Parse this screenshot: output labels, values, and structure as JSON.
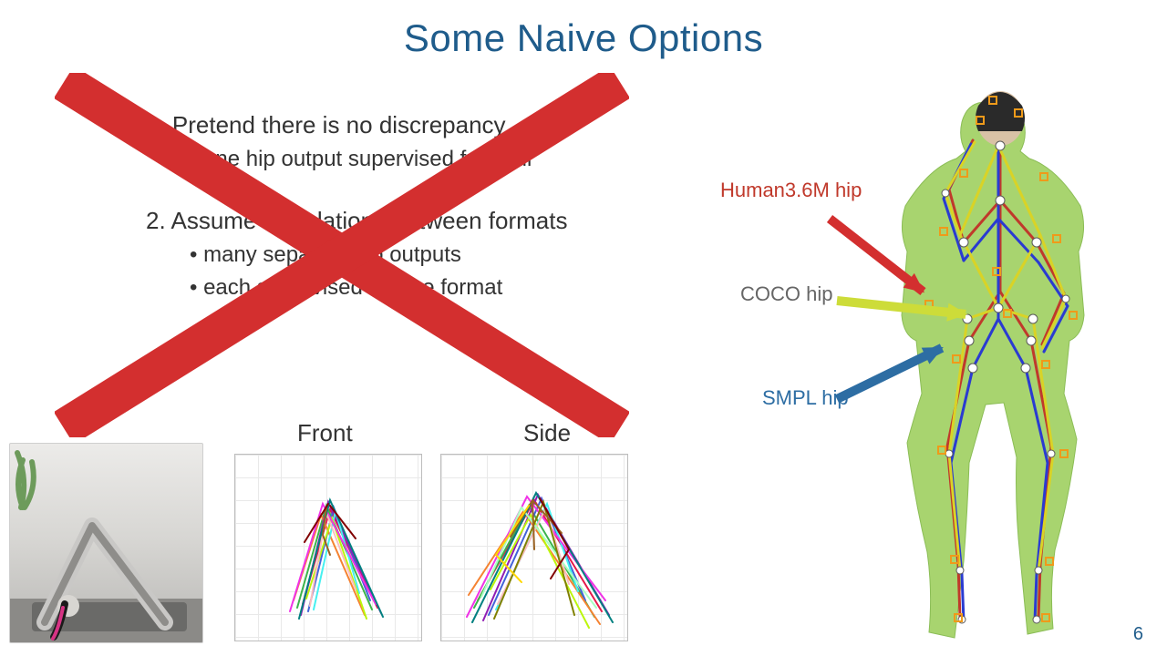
{
  "title": "Some Naive Options",
  "options": {
    "opt1": {
      "heading": "1. Pretend there is no discrepancy",
      "sub1": "• one hip output supervised from all"
    },
    "opt2": {
      "heading": "2. Assume no relations between formats",
      "sub1": "• many separate hip outputs",
      "sub2": "• each supervised by one format"
    }
  },
  "plot_labels": {
    "front": "Front",
    "side": "Side"
  },
  "annotations": {
    "human36m": {
      "label": "Human3.6M hip",
      "color": "#c0392b"
    },
    "coco": {
      "label": "COCO hip",
      "color": "#666666"
    },
    "smpl": {
      "label": "SMPL hip",
      "color": "#2d6da3"
    }
  },
  "page_number": "6"
}
